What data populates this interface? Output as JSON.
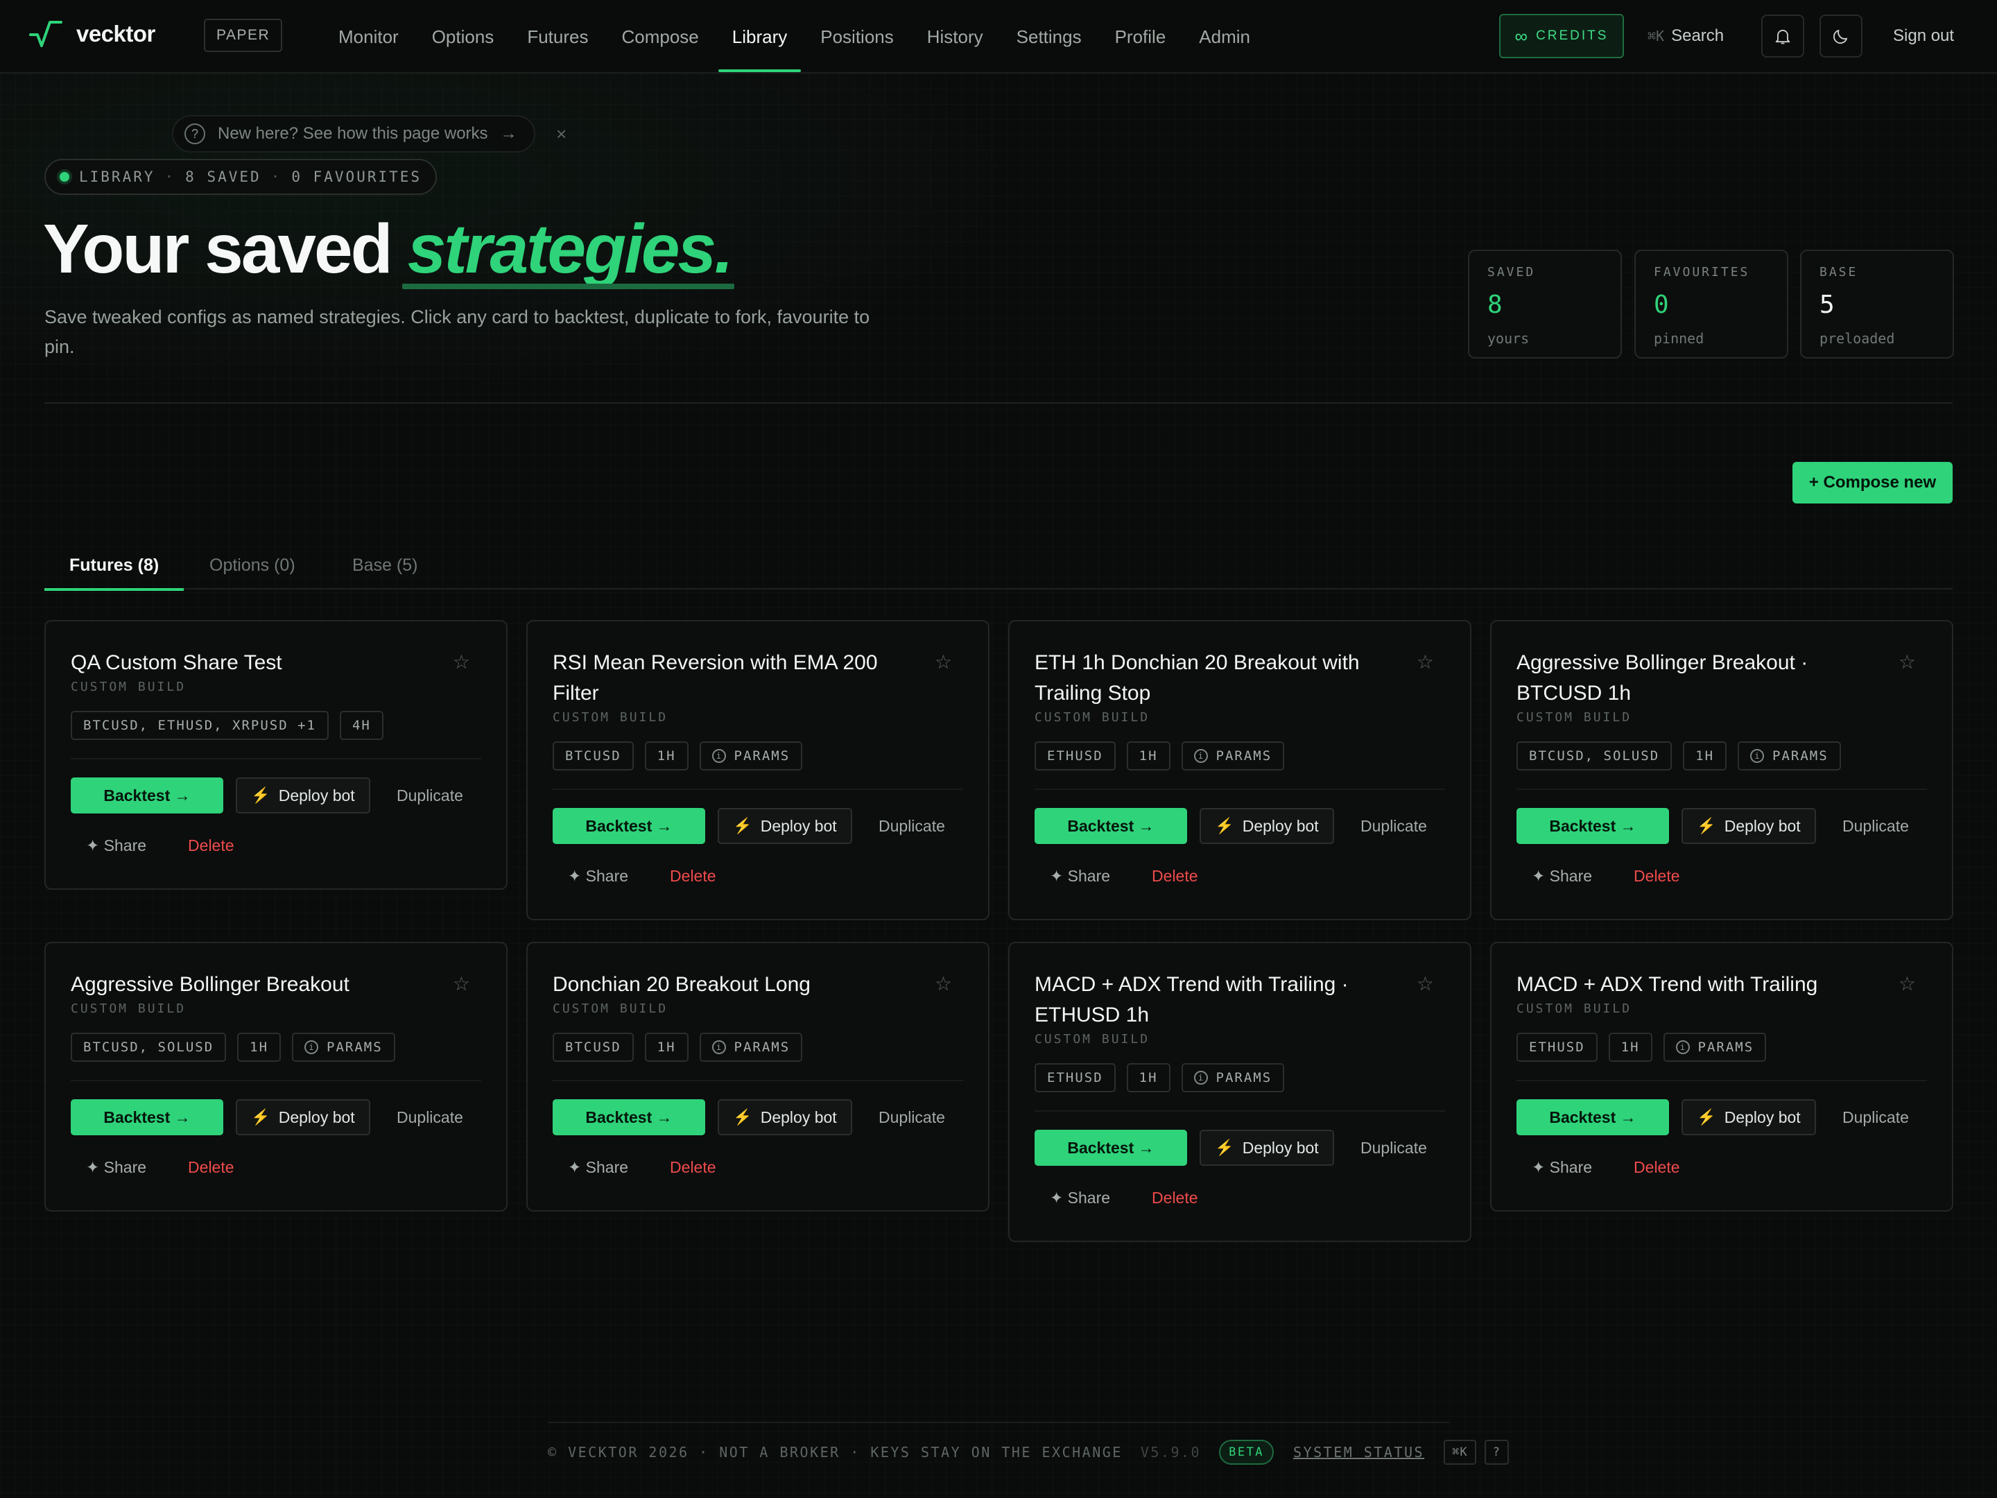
{
  "nav": {
    "brand": "vecktor",
    "mode_badge": "PAPER",
    "links": [
      "Monitor",
      "Options",
      "Futures",
      "Compose",
      "Library",
      "Positions",
      "History",
      "Settings",
      "Profile",
      "Admin"
    ],
    "active_link": "Library",
    "credits_symbol": "∞",
    "credits_label": "CREDITS",
    "search_shortcut": "⌘K",
    "search_label": "Search",
    "signout_label": "Sign out",
    "icons": [
      "bell-icon",
      "moon-icon"
    ]
  },
  "hint": {
    "icon": "?",
    "text": "New here? See how this page works",
    "arrow": "→",
    "close": "×"
  },
  "pill": {
    "label": "LIBRARY",
    "sep": "·",
    "saved": "8 SAVED",
    "favourites": "0 FAVOURITES"
  },
  "hero": {
    "title_plain": "Your saved",
    "title_accent": "strategies.",
    "subtitle": "Save tweaked configs as named strategies. Click any card to backtest, duplicate to fork, favourite to pin."
  },
  "stats": [
    {
      "label": "SAVED",
      "value": "8",
      "unit": "yours"
    },
    {
      "label": "FAVOURITES",
      "value": "0",
      "unit": "pinned"
    },
    {
      "label": "BASE",
      "value": "5",
      "unit": "preloaded"
    }
  ],
  "compose_label": "+ Compose new",
  "tabs": [
    "Futures (8)",
    "Options (0)",
    "Base (5)"
  ],
  "active_tab": "Futures (8)",
  "card_actions": {
    "backtest": "Backtest →",
    "deploy_icon": "⚡",
    "deploy": "Deploy bot",
    "duplicate": "Duplicate",
    "share": "✦ Share",
    "delete": "Delete",
    "star": "☆",
    "params_icon": "i"
  },
  "cards": [
    {
      "title": "QA Custom Share Test",
      "subtitle": "CUSTOM BUILD",
      "tags": [
        "BTCUSD, ETHUSD, XRPUSD +1",
        "4H"
      ],
      "params": false
    },
    {
      "title": "RSI Mean Reversion with EMA 200 Filter",
      "subtitle": "CUSTOM BUILD",
      "tags": [
        "BTCUSD",
        "1H"
      ],
      "params": true
    },
    {
      "title": "ETH 1h Donchian 20 Breakout with Trailing Stop",
      "subtitle": "CUSTOM BUILD",
      "tags": [
        "ETHUSD",
        "1H"
      ],
      "params": true
    },
    {
      "title": "Aggressive Bollinger Breakout · BTCUSD 1h",
      "subtitle": "CUSTOM BUILD",
      "tags": [
        "BTCUSD, SOLUSD",
        "1H"
      ],
      "params": true
    },
    {
      "title": "Aggressive Bollinger Breakout",
      "subtitle": "CUSTOM BUILD",
      "tags": [
        "BTCUSD, SOLUSD",
        "1H"
      ],
      "params": true
    },
    {
      "title": "Donchian 20 Breakout Long",
      "subtitle": "CUSTOM BUILD",
      "tags": [
        "BTCUSD",
        "1H"
      ],
      "params": true
    },
    {
      "title": "MACD + ADX Trend with Trailing · ETHUSD 1h",
      "subtitle": "CUSTOM BUILD",
      "tags": [
        "ETHUSD",
        "1H"
      ],
      "params": true
    },
    {
      "title": "MACD + ADX Trend with Trailing",
      "subtitle": "CUSTOM BUILD",
      "tags": [
        "ETHUSD",
        "1H"
      ],
      "params": true
    }
  ],
  "params_label": "PARAMS",
  "footer": {
    "text": "© VECKTOR 2026 · NOT A BROKER · KEYS STAY ON THE EXCHANGE",
    "version": "V5.9.0",
    "beta": "BETA",
    "status": "SYSTEM STATUS",
    "shortcut": "⌘K",
    "help": "?"
  },
  "colors": {
    "accent": "#2fd37a",
    "danger": "#ef4b4b",
    "background": "#0a0b0b"
  }
}
